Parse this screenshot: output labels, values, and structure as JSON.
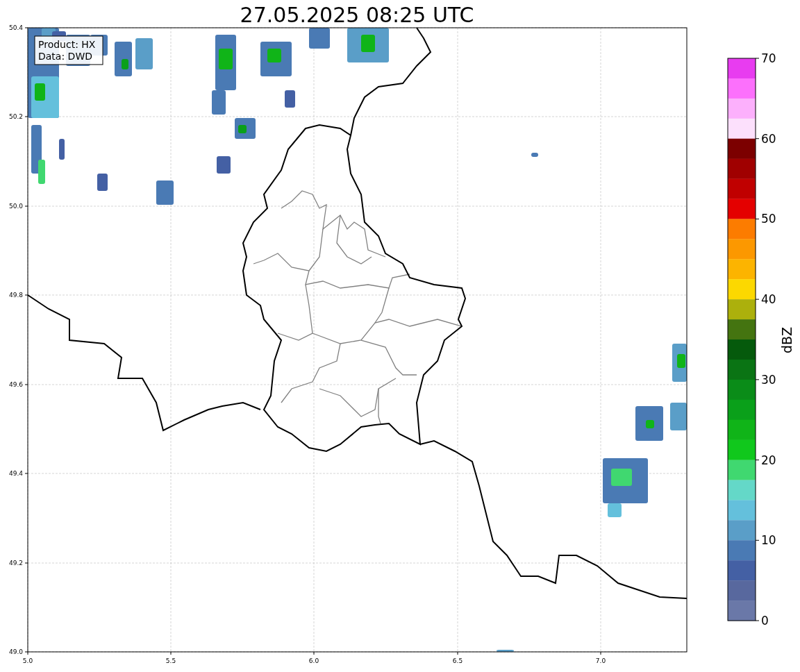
{
  "title": "27.05.2025 08:25 UTC",
  "info_box": [
    "Product: HX",
    "Data: DWD"
  ],
  "map": {
    "xticks": [
      "5.0",
      "5.5",
      "6.0",
      "6.5",
      "7.0"
    ],
    "yticks": [
      "50.4",
      "50.2",
      "50.0",
      "49.8",
      "49.6",
      "49.4",
      "49.2",
      "49.0"
    ]
  },
  "colorbar": {
    "label": "dBZ",
    "ticks": [
      "70",
      "60",
      "50",
      "40",
      "30",
      "20",
      "10",
      "0"
    ],
    "levels": [
      {
        "color": "#e83cf0"
      },
      {
        "color": "#fc70fc"
      },
      {
        "color": "#fcb0fc"
      },
      {
        "color": "#fce0fc"
      },
      {
        "color": "#7c0000"
      },
      {
        "color": "#a00000"
      },
      {
        "color": "#c00000"
      },
      {
        "color": "#e40000"
      },
      {
        "color": "#fc7c00"
      },
      {
        "color": "#fc9800"
      },
      {
        "color": "#fcb400"
      },
      {
        "color": "#fcd800"
      },
      {
        "color": "#acb00c"
      },
      {
        "color": "#447410"
      },
      {
        "color": "#055a0c"
      },
      {
        "color": "#0a7414"
      },
      {
        "color": "#0a8c18"
      },
      {
        "color": "#0aa01a"
      },
      {
        "color": "#10b418"
      },
      {
        "color": "#10c81c"
      },
      {
        "color": "#40d870"
      },
      {
        "color": "#64d8c8"
      },
      {
        "color": "#64c0dc"
      },
      {
        "color": "#5a9ec8"
      },
      {
        "color": "#4a7ab4"
      },
      {
        "color": "#4460a4"
      },
      {
        "color": "#58689e"
      },
      {
        "color": "#6a78a8"
      }
    ]
  }
}
